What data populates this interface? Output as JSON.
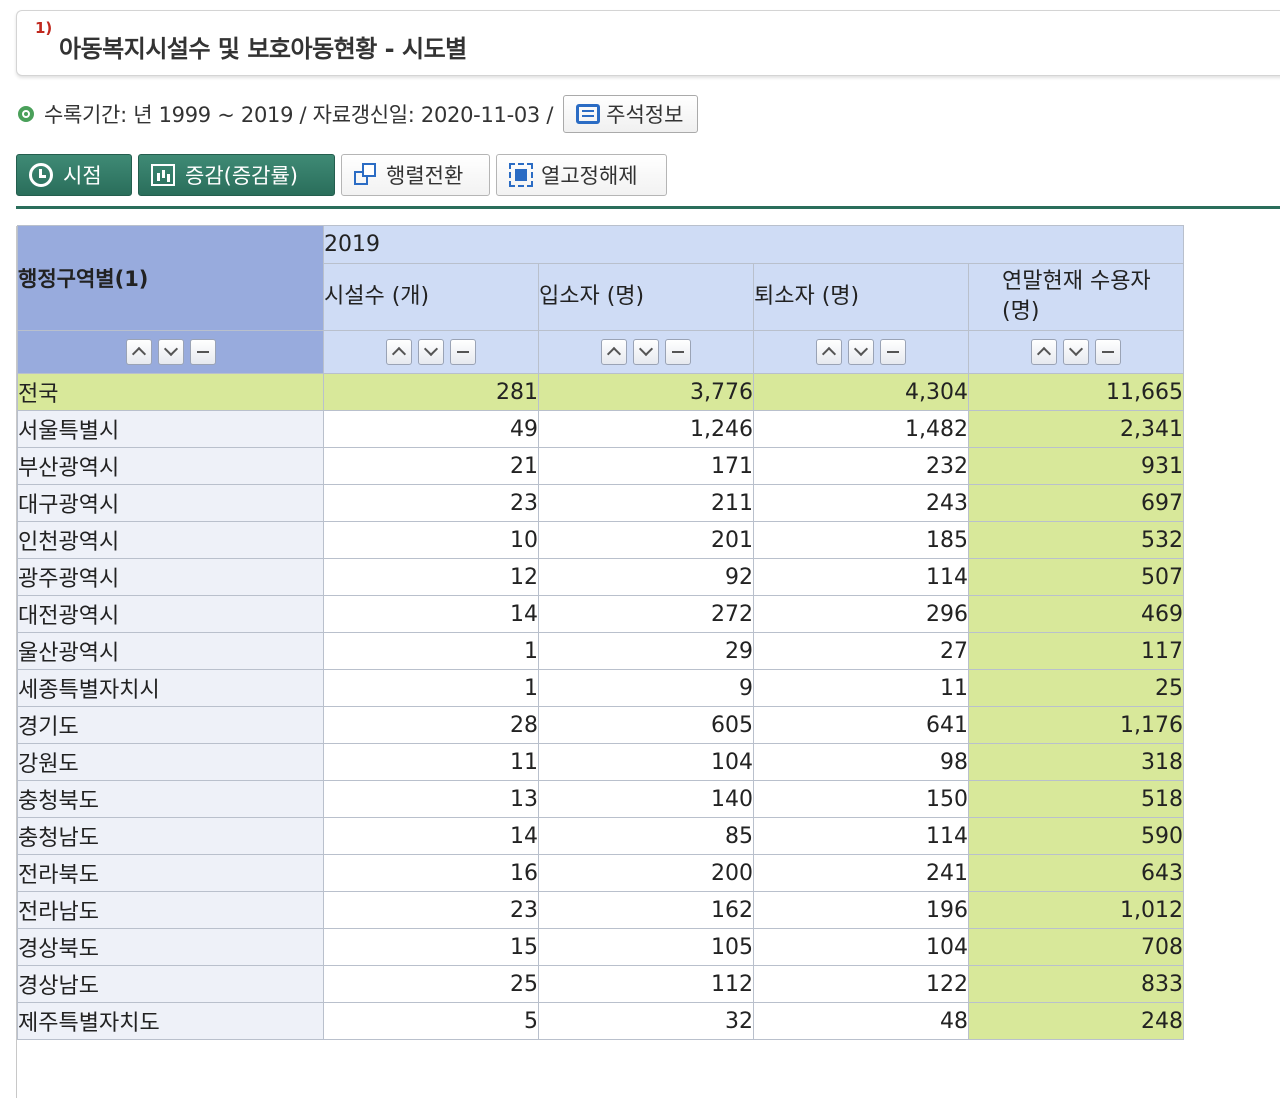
{
  "title": {
    "number": "1)",
    "text": "아동복지시설수 및 보호아동현황 - 시도별"
  },
  "period": {
    "text": "수록기간: 년 1999 ~ 2019 / 자료갱신일: 2020-11-03 /",
    "note_button": "주석정보"
  },
  "toolbar": {
    "time_point": "시점",
    "change": "증감(증감률)",
    "pivot": "행렬전환",
    "unfreeze": "열고정해제"
  },
  "table": {
    "corner_header": "행정구역별(1)",
    "year": "2019",
    "columns": [
      "시설수 (개)",
      "입소자 (명)",
      "퇴소자 (명)",
      "연말현재 수용자 (명)"
    ],
    "rows": [
      {
        "region": "전국",
        "values": [
          "281",
          "3,776",
          "4,304",
          "11,665"
        ]
      },
      {
        "region": "서울특별시",
        "values": [
          "49",
          "1,246",
          "1,482",
          "2,341"
        ]
      },
      {
        "region": "부산광역시",
        "values": [
          "21",
          "171",
          "232",
          "931"
        ]
      },
      {
        "region": "대구광역시",
        "values": [
          "23",
          "211",
          "243",
          "697"
        ]
      },
      {
        "region": "인천광역시",
        "values": [
          "10",
          "201",
          "185",
          "532"
        ]
      },
      {
        "region": "광주광역시",
        "values": [
          "12",
          "92",
          "114",
          "507"
        ]
      },
      {
        "region": "대전광역시",
        "values": [
          "14",
          "272",
          "296",
          "469"
        ]
      },
      {
        "region": "울산광역시",
        "values": [
          "1",
          "29",
          "27",
          "117"
        ]
      },
      {
        "region": "세종특별자치시",
        "values": [
          "1",
          "9",
          "11",
          "25"
        ]
      },
      {
        "region": "경기도",
        "values": [
          "28",
          "605",
          "641",
          "1,176"
        ]
      },
      {
        "region": "강원도",
        "values": [
          "11",
          "104",
          "98",
          "318"
        ]
      },
      {
        "region": "충청북도",
        "values": [
          "13",
          "140",
          "150",
          "518"
        ]
      },
      {
        "region": "충청남도",
        "values": [
          "14",
          "85",
          "114",
          "590"
        ]
      },
      {
        "region": "전라북도",
        "values": [
          "16",
          "200",
          "241",
          "643"
        ]
      },
      {
        "region": "전라남도",
        "values": [
          "23",
          "162",
          "196",
          "1,012"
        ]
      },
      {
        "region": "경상북도",
        "values": [
          "15",
          "105",
          "104",
          "708"
        ]
      },
      {
        "region": "경상남도",
        "values": [
          "25",
          "112",
          "122",
          "833"
        ]
      },
      {
        "region": "제주특별자치도",
        "values": [
          "5",
          "32",
          "48",
          "248"
        ]
      }
    ]
  },
  "colors": {
    "accent": "#2a6e5b",
    "header_blue": "#cfdcf5",
    "corner_blue": "#98abdd",
    "highlight": "#d8e89a"
  }
}
